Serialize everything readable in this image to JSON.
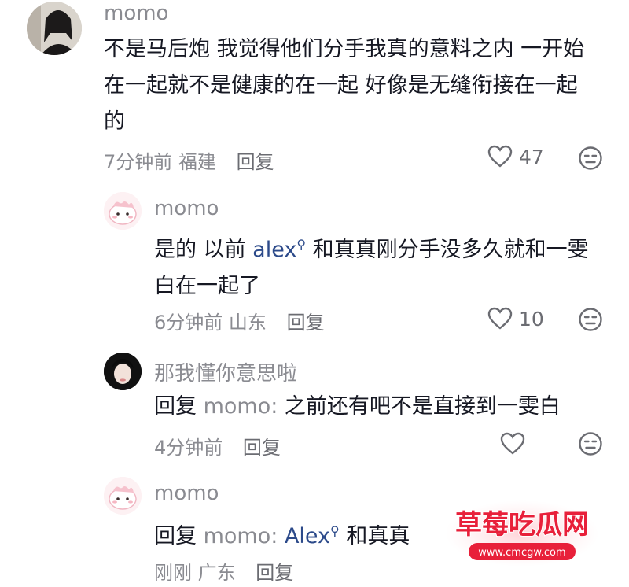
{
  "comments": [
    {
      "username": "momo",
      "text_lines": [
        "不是马后炮 我觉得他们分手我真的意料之内 一开始",
        "在一起就不是健康的在一起 好像是无缝衔接在一起",
        "的"
      ],
      "time": "7分钟前",
      "location": "福建",
      "reply_label": "回复",
      "likes": "47"
    },
    {
      "username": "momo",
      "text_pre": "是的 以前 ",
      "mention": "alex",
      "text_post": " 和真真刚分手没多久就和一雯",
      "text_line2": "白在一起了",
      "time": "6分钟前",
      "location": "山东",
      "reply_label": "回复",
      "likes": "10"
    },
    {
      "username": "那我懂你意思啦",
      "reply_prefix": "回复",
      "reply_target": "momo:",
      "text": " 之前还有吧不是直接到一雯白",
      "time": "4分钟前",
      "reply_label": "回复"
    },
    {
      "username": "momo",
      "reply_prefix": "回复",
      "reply_target": "momo:",
      "mention": "Alex",
      "text_post": "和真真",
      "time": "刚刚",
      "location": "广东",
      "reply_label": "回复"
    }
  ],
  "watermark": {
    "title": "草莓吃瓜网",
    "url": "www.cmcgw.com"
  },
  "colors": {
    "text": "#161823",
    "secondary": "#8a8b91",
    "mention": "#2c4a8a",
    "watermark_red": "#e8203a"
  }
}
